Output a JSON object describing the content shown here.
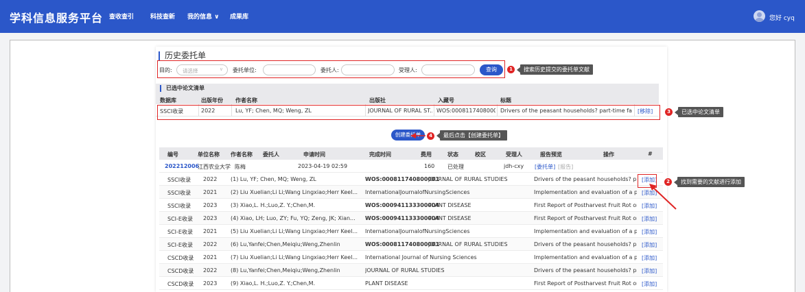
{
  "header": {
    "brand": "学科信息服务平台",
    "nav": [
      "查收查引",
      "科技查新",
      "我的信息 ∨",
      "成果库"
    ],
    "greeting": "您好 cyq"
  },
  "history": {
    "title": "历史委托单",
    "purpose_label": "目的:",
    "purpose_placeholder": "请选择",
    "unit_label": "委托单位:",
    "client_label": "委托人:",
    "handler_label": "受理人:",
    "query_button": "查询"
  },
  "annotations": {
    "a1": {
      "num": "1",
      "text": "搜索历史提交的委托单文献"
    },
    "a2": {
      "num": "2",
      "text": "找到需要的文献进行添加"
    },
    "a3": {
      "num": "3",
      "text": "已选中论文清单"
    },
    "a4": {
      "num": "4",
      "text": "最后点击【创建委托单】"
    }
  },
  "selected": {
    "title": "已选中论文清单",
    "headers": [
      "数据库",
      "出版年份",
      "作者名称",
      "出版社",
      "入藏号",
      "标题"
    ],
    "row": {
      "db": "SSCI收录",
      "year": "2022",
      "authors": "Lu, YF; Chen, MQ; Weng, ZL",
      "publisher": "JOURNAL OF RURAL ST...",
      "accession": "WOS:0008117408000...",
      "title": "Drivers of the peasant households? part-time farm...",
      "action": "[移除]"
    }
  },
  "create_button": "创建委托单",
  "list": {
    "headers": [
      "编号",
      "单位名称",
      "作者名称",
      "委托人",
      "申请时间",
      "完成时间",
      "费用",
      "状态",
      "校区",
      "受理人",
      "报告预览",
      "操作",
      "#"
    ],
    "order": {
      "id": "202212006",
      "unit": "江西农业大学",
      "author": "陈梅",
      "time": "2023-04-19 02:59",
      "fee": "160",
      "status": "已处理",
      "handler": "jdh-cxy",
      "preview_a": "[委托单]",
      "preview_b": "[报告]"
    },
    "rows": [
      {
        "db": "SSCI收录",
        "year": "2022",
        "authors": "(1) Lu, YF; Chen, MQ; Weng, ZL",
        "wos": "WOS:000811740800001",
        "src": "JOURNAL OF RURAL STUDIES",
        "title": "Drivers of the peasant households? par...",
        "action": "[添加]"
      },
      {
        "db": "SSCI收录",
        "year": "2021",
        "authors": "(2) Liu Xuelian;Li Li;Wang Lingxiao;Herr Keel...",
        "wos": "",
        "src": "InternationalJournalofNursingSciences",
        "title": "Implementation and evaluation of a pai...",
        "action": "[添加]"
      },
      {
        "db": "SSCI收录",
        "year": "2023",
        "authors": "(3) Xiao,L. H.;Luo,Z. Y.;Chen,M.",
        "wos": "WOS:000941133300004",
        "src": "PLANT DISEASE",
        "title": "First Report of Postharvest Fruit Rot on ...",
        "action": "[添加]"
      },
      {
        "db": "SCI-E收录",
        "year": "2023",
        "authors": "(4) Xiao, LH; Luo, ZY; Fu, YQ; Zeng, JK; Xian...",
        "wos": "WOS:000941133300004",
        "src": "PLANT DISEASE",
        "title": "First Report of Postharvest Fruit Rot on ...",
        "action": "[添加]"
      },
      {
        "db": "SCI-E收录",
        "year": "2021",
        "authors": "(5) Liu Xuelian;Li Li;Wang Lingxiao;Herr Keel...",
        "wos": "",
        "src": "InternationalJournalofNursingSciences",
        "title": "Implementation and evaluation of a pai...",
        "action": "[添加]"
      },
      {
        "db": "SCI-E收录",
        "year": "2022",
        "authors": "(6) Lu,Yanfei;Chen,Meiqiu;Weng,Zhenlin",
        "wos": "WOS:000811740800001",
        "src": "JOURNAL OF RURAL STUDIES",
        "title": "Drivers of the peasant households? par...",
        "action": "[添加]"
      },
      {
        "db": "CSCD收录",
        "year": "2021",
        "authors": "(7) Liu Xuelian;Li Li;Wang Lingxiao;Herr Keel...",
        "wos": "",
        "src": "International Journal of Nursing Sciences",
        "title": "Implementation and evaluation of a pai...",
        "action": "[添加]"
      },
      {
        "db": "CSCD收录",
        "year": "2022",
        "authors": "(8) Lu,Yanfei;Chen,Meiqiu;Weng,Zhenlin",
        "wos": "",
        "src": "JOURNAL OF RURAL STUDIES",
        "title": "Drivers of the peasant households? par...",
        "action": "[添加]"
      },
      {
        "db": "CSCD收录",
        "year": "2023",
        "authors": "(9) Xiao,L. H.;Luo,Z. Y.;Chen,M.",
        "wos": "",
        "src": "PLANT DISEASE",
        "title": "First Report of Postharvest Fruit Rot on ...",
        "action": "[添加]"
      }
    ]
  },
  "colors": {
    "brand": "#2b57c9",
    "annotation_red": "#e02424"
  }
}
